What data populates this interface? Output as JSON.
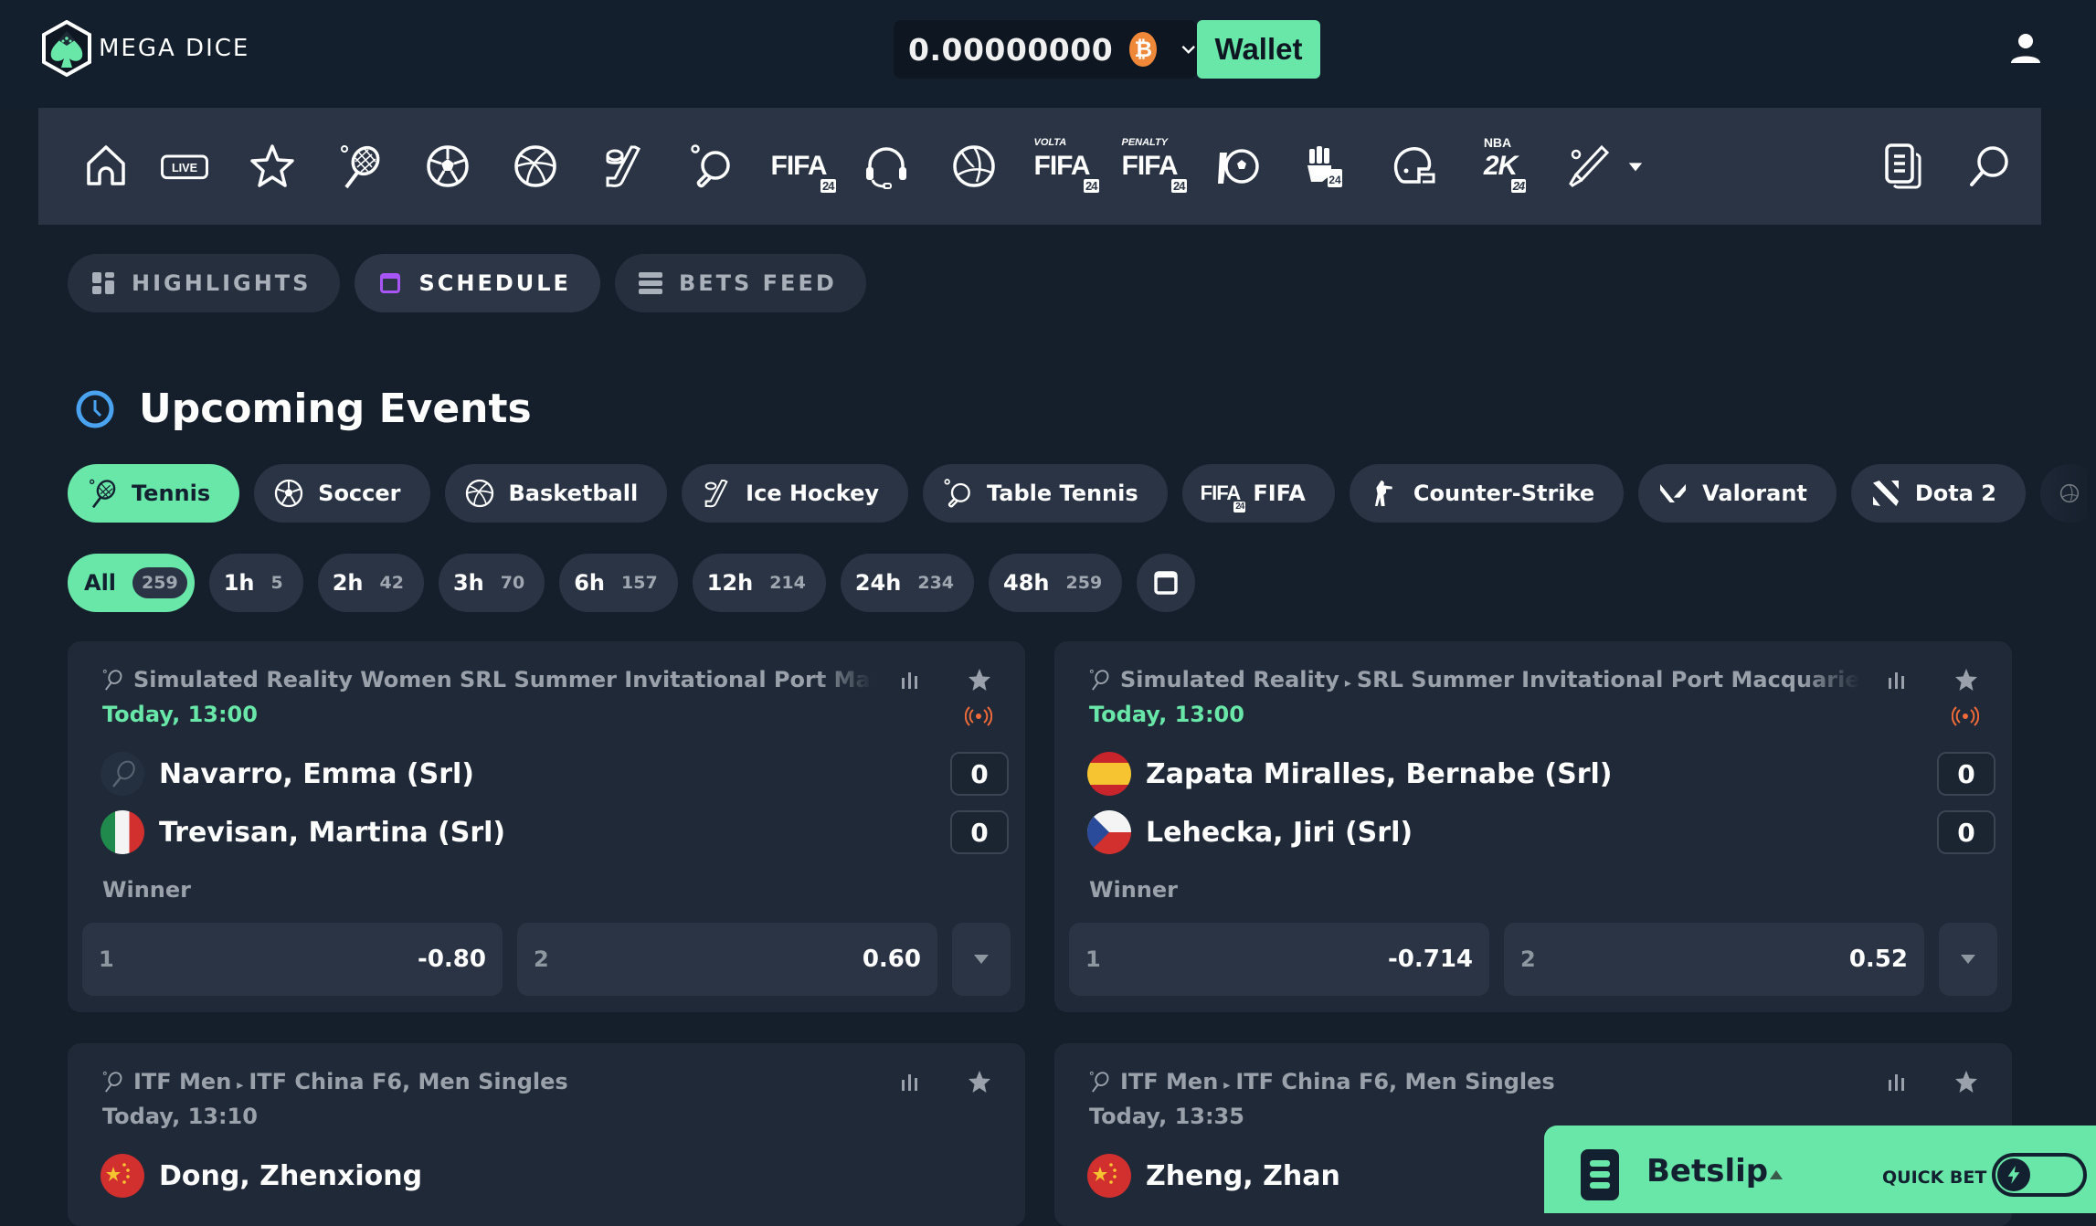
{
  "brand": {
    "name": "MEGA DICE",
    "accent": "#68e7a8"
  },
  "header": {
    "balance": "0.00000000",
    "currency_icon": "bitcoin-icon",
    "currency_symbol": "₿",
    "wallet_label": "Wallet"
  },
  "sport_nav": {
    "items": [
      {
        "name": "home",
        "icon": "home-icon"
      },
      {
        "name": "live",
        "icon": "live-icon",
        "label": "LIVE"
      },
      {
        "name": "favorites",
        "icon": "star-icon"
      },
      {
        "name": "tennis",
        "icon": "tennis-icon"
      },
      {
        "name": "soccer",
        "icon": "soccer-icon"
      },
      {
        "name": "basketball",
        "icon": "basketball-icon"
      },
      {
        "name": "ice-hockey",
        "icon": "ice-hockey-icon"
      },
      {
        "name": "table-tennis",
        "icon": "table-tennis-icon"
      },
      {
        "name": "fifa",
        "icon": "fifa-icon",
        "label": "FIFA",
        "badge": "24"
      },
      {
        "name": "esports",
        "icon": "headset-icon"
      },
      {
        "name": "volleyball",
        "icon": "volleyball-icon"
      },
      {
        "name": "volta-fifa",
        "icon": "volta-fifa-icon",
        "top": "VOLTA",
        "label": "FIFA",
        "badge": "24"
      },
      {
        "name": "penalty-fifa",
        "icon": "penalty-fifa-icon",
        "top": "PENALTY",
        "label": "FIFA",
        "badge": "24"
      },
      {
        "name": "efootball",
        "icon": "efootball-icon"
      },
      {
        "name": "efighting",
        "icon": "fist-icon",
        "badge": "24"
      },
      {
        "name": "american-football",
        "icon": "helmet-icon"
      },
      {
        "name": "nba2k",
        "icon": "nba2k-icon",
        "top": "NBA",
        "label": "2K",
        "badge": "24"
      },
      {
        "name": "cricket",
        "icon": "cricket-icon"
      }
    ],
    "more_icon": "caret-down-icon",
    "betslip_history_icon": "document-icon",
    "search_icon": "search-icon"
  },
  "tabs": [
    {
      "label": "HIGHLIGHTS",
      "icon": "grid-icon",
      "active": false
    },
    {
      "label": "SCHEDULE",
      "icon": "calendar-icon",
      "active": true
    },
    {
      "label": "BETS FEED",
      "icon": "list-icon",
      "active": false
    }
  ],
  "section": {
    "title": "Upcoming Events",
    "icon": "clock-icon"
  },
  "sport_filters": [
    {
      "label": "Tennis",
      "icon": "tennis-icon",
      "active": true
    },
    {
      "label": "Soccer",
      "icon": "soccer-icon"
    },
    {
      "label": "Basketball",
      "icon": "basketball-icon"
    },
    {
      "label": "Ice Hockey",
      "icon": "ice-hockey-icon"
    },
    {
      "label": "Table Tennis",
      "icon": "table-tennis-icon"
    },
    {
      "label": "FIFA",
      "icon": "fifa-icon"
    },
    {
      "label": "Counter-Strike",
      "icon": "counter-strike-icon"
    },
    {
      "label": "Valorant",
      "icon": "valorant-icon"
    },
    {
      "label": "Dota 2",
      "icon": "dota2-icon"
    }
  ],
  "time_filters": [
    {
      "label": "All",
      "count": "259",
      "active": true
    },
    {
      "label": "1h",
      "count": "5"
    },
    {
      "label": "2h",
      "count": "42"
    },
    {
      "label": "3h",
      "count": "70"
    },
    {
      "label": "6h",
      "count": "157"
    },
    {
      "label": "12h",
      "count": "214"
    },
    {
      "label": "24h",
      "count": "234"
    },
    {
      "label": "48h",
      "count": "259"
    }
  ],
  "events": [
    {
      "league": "Simulated Reality Women SRL Summer Invitational Port Macquarie",
      "category": "",
      "time": "Today, 13:00",
      "live_soon": true,
      "teams": [
        {
          "name": "Navarro, Emma (Srl)",
          "flag": "generic",
          "score": "0"
        },
        {
          "name": "Trevisan, Martina (Srl)",
          "flag": "italy",
          "score": "0"
        }
      ],
      "market": "Winner",
      "odds": [
        {
          "label": "1",
          "value": "-0.80"
        },
        {
          "label": "2",
          "value": "0.60"
        }
      ]
    },
    {
      "category": "Simulated Reality",
      "league": "SRL Summer Invitational Port Macquarie, AUS",
      "time": "Today, 13:00",
      "live_soon": true,
      "teams": [
        {
          "name": "Zapata Miralles, Bernabe (Srl)",
          "flag": "spain",
          "score": "0"
        },
        {
          "name": "Lehecka, Jiri (Srl)",
          "flag": "czech",
          "score": "0"
        }
      ],
      "market": "Winner",
      "odds": [
        {
          "label": "1",
          "value": "-0.714"
        },
        {
          "label": "2",
          "value": "0.52"
        }
      ]
    },
    {
      "category": "ITF Men",
      "league": "ITF China F6, Men Singles",
      "time": "Today, 13:10",
      "teams": [
        {
          "name": "Dong, Zhenxiong",
          "flag": "china"
        }
      ]
    },
    {
      "category": "ITF Men",
      "league": "ITF China F6, Men Singles",
      "time": "Today, 13:35",
      "teams": [
        {
          "name": "Zheng, Zhan",
          "flag": "china"
        }
      ]
    }
  ],
  "betslip": {
    "label": "Betslip",
    "quick_bet_label": "QUICK BET",
    "quick_bet_on": false
  }
}
